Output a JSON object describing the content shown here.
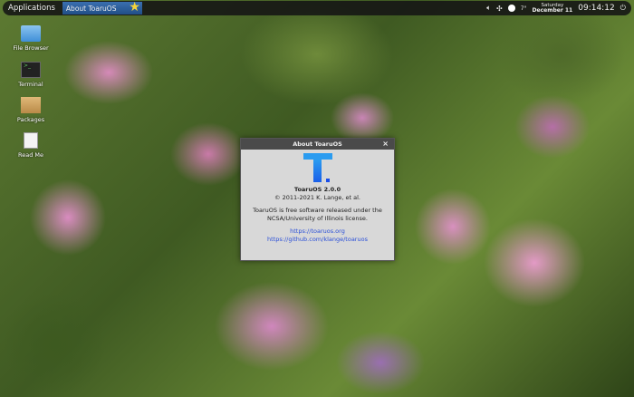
{
  "panel": {
    "applications": "Applications",
    "task": "About ToaruOS",
    "temperature": "7°",
    "day": "Saturday",
    "date": "December 11",
    "time": "09:14:12"
  },
  "desktop": [
    {
      "label": "File Browser",
      "icon": "folder-icon"
    },
    {
      "label": "Terminal",
      "icon": "terminal-icon"
    },
    {
      "label": "Packages",
      "icon": "package-icon"
    },
    {
      "label": "Read Me",
      "icon": "document-icon"
    }
  ],
  "dialog": {
    "title": "About ToaruOS",
    "close": "×",
    "name": "ToaruOS 2.0.0",
    "copyright": "© 2011-2021 K. Lange, et al.",
    "license1": "ToaruOS is free software released under the",
    "license2": "NCSA/University of Illinois license.",
    "link1": "https://toaruos.org",
    "link2": "https://github.com/klange/toaruos"
  }
}
